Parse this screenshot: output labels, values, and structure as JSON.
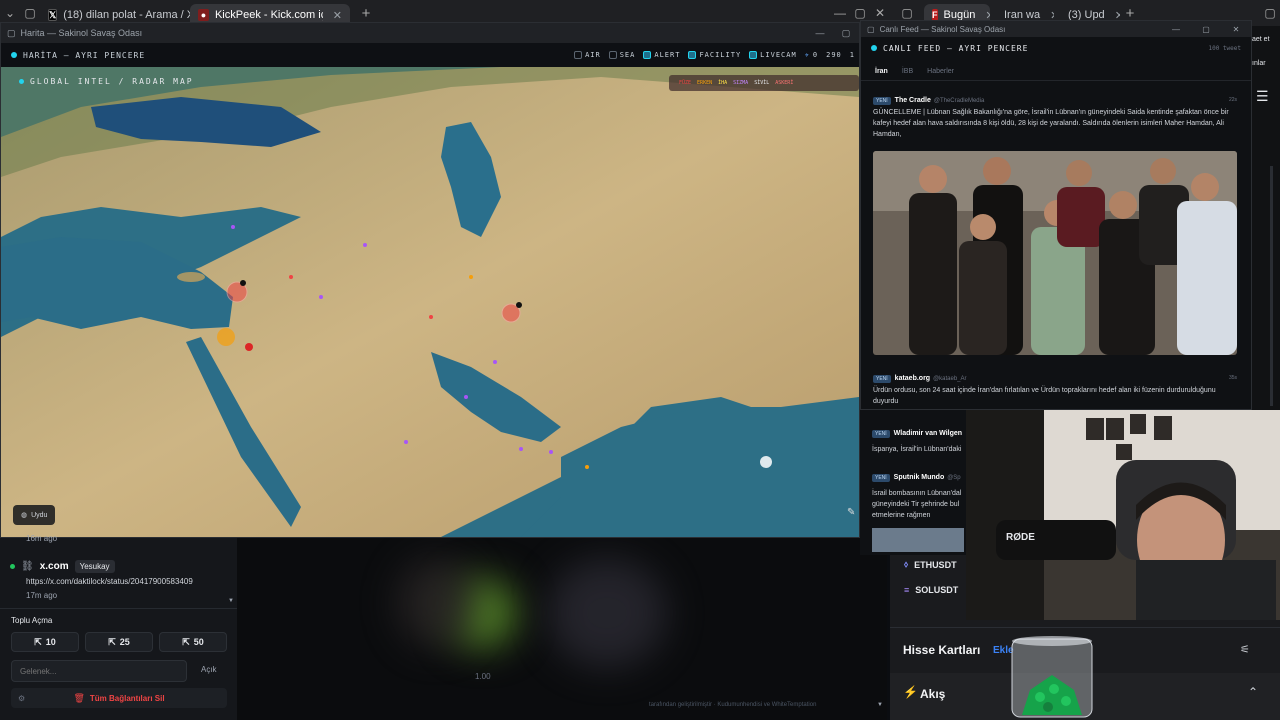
{
  "browser_left": {
    "tabs": [
      {
        "label": "(18) dilan polat - Arama / X",
        "icon": "x-logo",
        "active": false
      },
      {
        "label": "KickPeek - Kick.com için Gerçek Za",
        "icon": "kickpeek-logo",
        "active": true
      }
    ],
    "new_tab": "+"
  },
  "browser_right": {
    "tabs": [
      {
        "label": "Bugün",
        "icon": "f-logo"
      },
      {
        "label": "Iran wa",
        "icon": "orange-logo"
      },
      {
        "label": "(3) Upd",
        "icon": "orange-logo"
      }
    ],
    "new_tab": "+",
    "edge_text": "aet et",
    "edge_text2": "ınlar"
  },
  "map_window": {
    "window_title": "Harita — Sakinol Savaş Odası",
    "panel_title": "HARİTA — AYRI PENCERE",
    "filters": [
      {
        "label": "AIR",
        "checked": false
      },
      {
        "label": "SEA",
        "checked": false
      },
      {
        "label": "ALERT",
        "checked": true
      },
      {
        "label": "FACILITY",
        "checked": true
      },
      {
        "label": "LIVECAM",
        "checked": true
      }
    ],
    "counts": [
      "0",
      "290",
      "1"
    ],
    "map_label": "GLOBAL INTEL / RADAR MAP",
    "legend": [
      "FÜZE",
      "ERKEN",
      "İHA",
      "SIZMA",
      "SİVİL",
      "ASKERİ"
    ],
    "satellite_button": "Uydu"
  },
  "left_panel": {
    "ago_top": "16m ago",
    "post": {
      "site": "x.com",
      "user": "Yesukay",
      "url": "https://x.com/daktilock/status/2041790058340​9",
      "ago": "17m ago"
    },
    "bulk_open_label": "Toplu Açma",
    "bulk_buttons": [
      "10",
      "25",
      "50"
    ],
    "input_placeholder": "Gelenek...",
    "open_label": "Açık",
    "delete_all": "Tüm Bağlantıları Sil"
  },
  "video_area": {
    "value": "1.00",
    "credits": "tarafından geliştirilmiştir · Kudumunhendisi ve WhiteTemptation"
  },
  "feed_window": {
    "window_title": "Canlı Feed — Sakinol Savaş Odası",
    "panel_title": "CANLI FEED — AYRI PENCERE",
    "tweet_count": "100 tweet",
    "tabs": [
      "İran",
      "İBB",
      "Haberler"
    ],
    "items": [
      {
        "badge": "YENİ",
        "author": "The Cradle",
        "handle": "@TheCradleMedia",
        "age": "22s",
        "text": "GÜNCELLEME | Lübnan Sağlık Bakanlığı'na göre, İsrail'in Lübnan'ın güneyindeki Saida kentinde şafaktan önce bir kafeyi hedef alan hava saldırısında 8 kişi öldü, 28 kişi de yaralandı. Saldırıda ölenlerin isimleri Maher Hamdan, Ali Hamdan,"
      },
      {
        "badge": "YENİ",
        "author": "kataeb.org",
        "handle": "@kataeb_Ar",
        "age": "35s",
        "text": "Ürdün ordusu, son 24 saat içinde İran'dan fırlatılan ve Ürdün topraklarını hedef alan iki füzenin durdurulduğunu duyurdu"
      },
      {
        "badge": "YENİ",
        "author": "Wladimir van Wilgen",
        "handle": "",
        "age": "",
        "text": "İspanya, İsrail'in Lübnan'daki"
      },
      {
        "badge": "YENİ",
        "author": "Sputnik Mundo",
        "handle": "@Sp",
        "age": "",
        "text": "İsrail bombasının Lübnan'dal güneyindeki Tir şehrinde bul etmelerine rağmen"
      }
    ]
  },
  "right_side": {
    "crypto": [
      "ETHUSDT",
      "SOLUSDT"
    ],
    "stock_cards_title": "Hisse Kartları",
    "stock_cards_add": "Ekle",
    "flow_title": "Akış",
    "cam_overlay": "RØDE"
  },
  "colors": {
    "accent": "#22d3ee",
    "danger": "#ef4444",
    "link": "#3b82f6"
  }
}
